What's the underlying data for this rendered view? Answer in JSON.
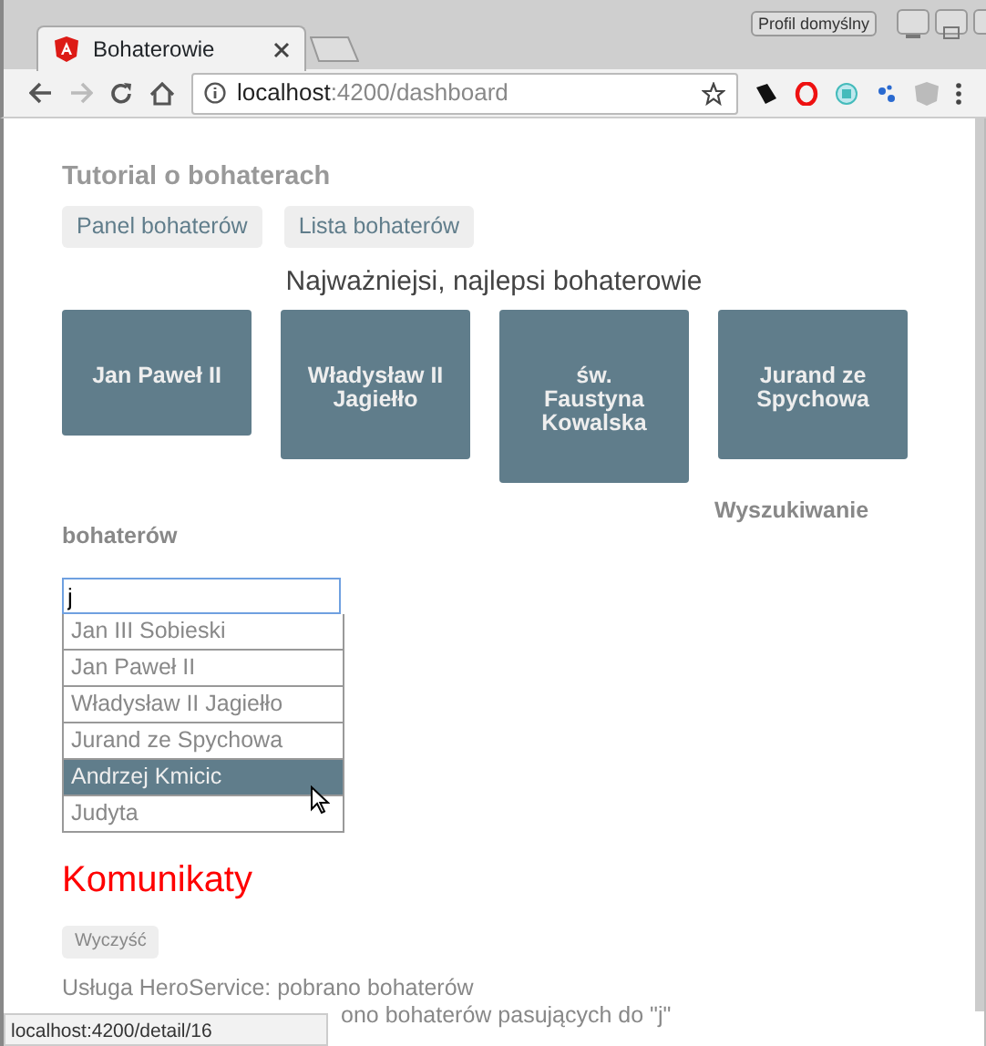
{
  "browser": {
    "tab_title": "Bohaterowie",
    "profile": "Profil domyślny",
    "url_host": "localhost",
    "url_path": ":4200/dashboard",
    "status_url": "localhost:4200/detail/16"
  },
  "app": {
    "title": "Tutorial o bohaterach",
    "nav": [
      {
        "label": "Panel bohaterów"
      },
      {
        "label": "Lista bohaterów"
      }
    ]
  },
  "dashboard": {
    "heading": "Najważniejsi, najlepsi bohaterowie",
    "heroes": [
      "Jan Paweł II",
      "Władysław II Jagiełło",
      "św. Faustyna Kowalska",
      "Jurand ze Spychowa"
    ]
  },
  "search": {
    "heading_line_1": "Wyszukiwanie",
    "heading_line_2": "bohaterów",
    "query": "j",
    "results": [
      {
        "name": "Jan III Sobieski",
        "selected": false
      },
      {
        "name": "Jan Paweł II",
        "selected": false
      },
      {
        "name": "Władysław II Jagiełło",
        "selected": false
      },
      {
        "name": "Jurand ze Spychowa",
        "selected": false
      },
      {
        "name": "Andrzej Kmicic",
        "selected": true
      },
      {
        "name": "Judyta",
        "selected": false
      }
    ]
  },
  "messages": {
    "title": "Komunikaty",
    "clear_button": "Wyczyść",
    "lines": [
      {
        "kind": "full",
        "text": "Usługa HeroService: pobrano bohaterów"
      },
      {
        "kind": "tail",
        "text": "ono bohaterów pasujących do \"j\""
      }
    ]
  }
}
